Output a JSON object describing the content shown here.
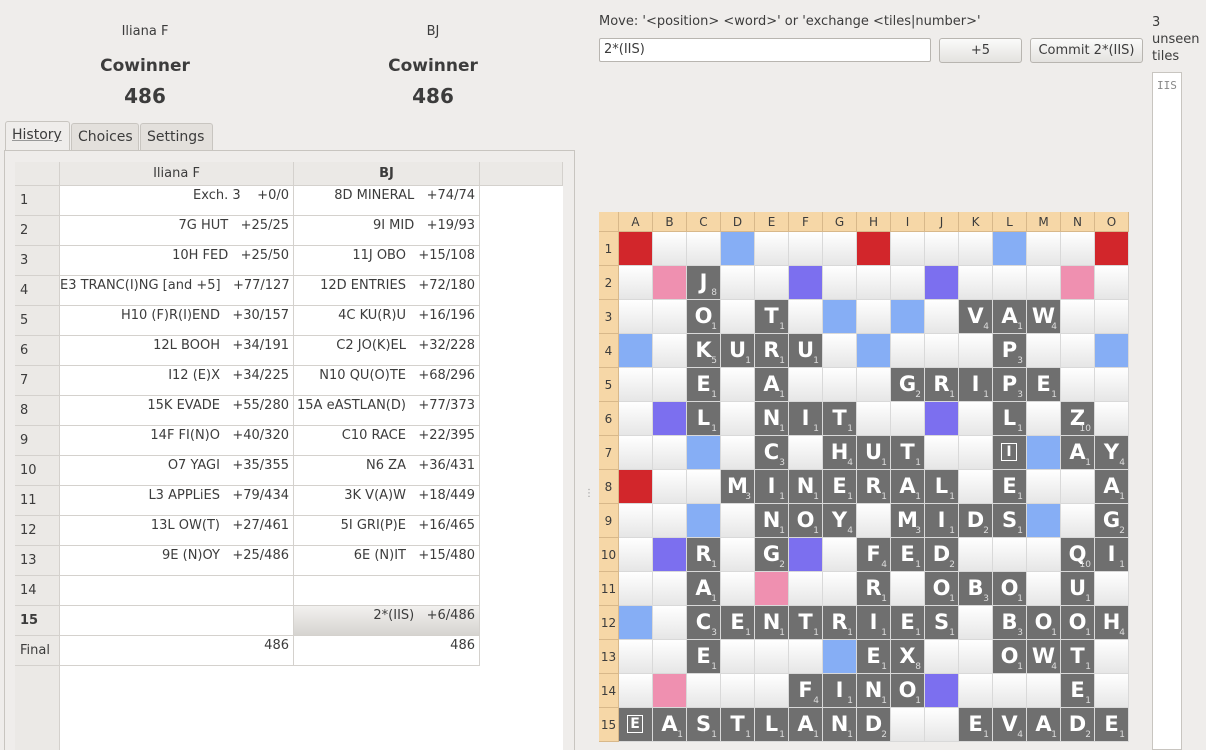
{
  "players": [
    {
      "name": "Iliana F",
      "status": "Cowinner",
      "score": "486"
    },
    {
      "name": "BJ",
      "status": "Cowinner",
      "score": "486"
    }
  ],
  "tabs": [
    "History",
    "Choices",
    "Settings"
  ],
  "history": {
    "columns": [
      "Iliana F",
      "BJ"
    ],
    "rows": [
      {
        "n": "1",
        "a": "Exch. 3    +0/0",
        "b": "8D MINERAL   +74/74"
      },
      {
        "n": "2",
        "a": "7G HUT   +25/25",
        "b": "9I MID   +19/93"
      },
      {
        "n": "3",
        "a": "10H FED   +25/50",
        "b": "11J OBO   +15/108"
      },
      {
        "n": "4",
        "a": "E3 TRANC(I)NG [and +5]   +77/127",
        "b": "12D ENTRIES   +72/180"
      },
      {
        "n": "5",
        "a": "H10 (F)R(I)END   +30/157",
        "b": "4C KU(R)U   +16/196"
      },
      {
        "n": "6",
        "a": "12L BOOH   +34/191",
        "b": "C2 JO(K)EL   +32/228"
      },
      {
        "n": "7",
        "a": "I12 (E)X   +34/225",
        "b": "N10 QU(O)TE   +68/296"
      },
      {
        "n": "8",
        "a": "15K EVADE   +55/280",
        "b": "15A eASTLAN(D)   +77/373"
      },
      {
        "n": "9",
        "a": "14F FI(N)O   +40/320",
        "b": "C10 RACE   +22/395"
      },
      {
        "n": "10",
        "a": "O7 YAGI   +35/355",
        "b": "N6 ZA   +36/431"
      },
      {
        "n": "11",
        "a": "L3 APPLiES   +79/434",
        "b": "3K V(A)W   +18/449"
      },
      {
        "n": "12",
        "a": "13L OW(T)   +27/461",
        "b": "5I GRI(P)E   +16/465"
      },
      {
        "n": "13",
        "a": "9E (N)OY   +25/486",
        "b": "6E (N)IT   +15/480"
      },
      {
        "n": "14",
        "a": "",
        "b": ""
      },
      {
        "n": "15",
        "a": "",
        "b": "2*(IIS)   +6/486"
      }
    ],
    "final": {
      "label": "Final",
      "a": "486",
      "b": "486"
    }
  },
  "move": {
    "label": "Move: '<position> <word>' or 'exchange <tiles|number>'",
    "value": "2*(IIS)",
    "plus_button": "+5",
    "commit_button": "Commit 2*(IIS)"
  },
  "unseen": {
    "label": "3 unseen tiles",
    "tiles": "IIS"
  },
  "board": {
    "cols": [
      "A",
      "B",
      "C",
      "D",
      "E",
      "F",
      "G",
      "H",
      "I",
      "J",
      "K",
      "L",
      "M",
      "N",
      "O"
    ],
    "rows": [
      "1",
      "2",
      "3",
      "4",
      "5",
      "6",
      "7",
      "8",
      "9",
      "10",
      "11",
      "12",
      "13",
      "14",
      "15"
    ],
    "premium": {
      "tw": [
        "A1",
        "H1",
        "O1",
        "A8"
      ],
      "dw": [
        "B2",
        "N2",
        "E11",
        "B14"
      ],
      "tl": [
        "F2",
        "J2",
        "B6",
        "J6",
        "B10",
        "F10",
        "J14"
      ],
      "dl": [
        "D1",
        "L1",
        "G3",
        "I3",
        "A4",
        "H4",
        "O4",
        "C7",
        "M7",
        "C9",
        "M9",
        "A12",
        "G13"
      ]
    },
    "tiles": [
      {
        "cell": "C2",
        "letter": "J",
        "points": "8"
      },
      {
        "cell": "C3",
        "letter": "O",
        "points": "1"
      },
      {
        "cell": "E3",
        "letter": "T",
        "points": "1"
      },
      {
        "cell": "K3",
        "letter": "V",
        "points": "4"
      },
      {
        "cell": "L3",
        "letter": "A",
        "points": "1"
      },
      {
        "cell": "M3",
        "letter": "W",
        "points": "4"
      },
      {
        "cell": "C4",
        "letter": "K",
        "points": "5"
      },
      {
        "cell": "D4",
        "letter": "U",
        "points": "1"
      },
      {
        "cell": "E4",
        "letter": "R",
        "points": "1"
      },
      {
        "cell": "F4",
        "letter": "U",
        "points": "1"
      },
      {
        "cell": "L4",
        "letter": "P",
        "points": "3"
      },
      {
        "cell": "C5",
        "letter": "E",
        "points": "1"
      },
      {
        "cell": "E5",
        "letter": "A",
        "points": "1"
      },
      {
        "cell": "I5",
        "letter": "G",
        "points": "2"
      },
      {
        "cell": "J5",
        "letter": "R",
        "points": "1"
      },
      {
        "cell": "K5",
        "letter": "I",
        "points": "1"
      },
      {
        "cell": "L5",
        "letter": "P",
        "points": "3"
      },
      {
        "cell": "M5",
        "letter": "E",
        "points": "1"
      },
      {
        "cell": "C6",
        "letter": "L",
        "points": "1"
      },
      {
        "cell": "E6",
        "letter": "N",
        "points": "1"
      },
      {
        "cell": "F6",
        "letter": "I",
        "points": "1"
      },
      {
        "cell": "G6",
        "letter": "T",
        "points": "1"
      },
      {
        "cell": "L6",
        "letter": "L",
        "points": "1"
      },
      {
        "cell": "N6",
        "letter": "Z",
        "points": "10"
      },
      {
        "cell": "E7",
        "letter": "C",
        "points": "3"
      },
      {
        "cell": "G7",
        "letter": "H",
        "points": "4"
      },
      {
        "cell": "H7",
        "letter": "U",
        "points": "1"
      },
      {
        "cell": "I7",
        "letter": "T",
        "points": "1"
      },
      {
        "cell": "L7",
        "letter": "I",
        "points": "",
        "blank": true
      },
      {
        "cell": "N7",
        "letter": "A",
        "points": "1"
      },
      {
        "cell": "O7",
        "letter": "Y",
        "points": "4"
      },
      {
        "cell": "D8",
        "letter": "M",
        "points": "3"
      },
      {
        "cell": "E8",
        "letter": "I",
        "points": "1"
      },
      {
        "cell": "F8",
        "letter": "N",
        "points": "1"
      },
      {
        "cell": "G8",
        "letter": "E",
        "points": "1"
      },
      {
        "cell": "H8",
        "letter": "R",
        "points": "1"
      },
      {
        "cell": "I8",
        "letter": "A",
        "points": "1"
      },
      {
        "cell": "J8",
        "letter": "L",
        "points": "1"
      },
      {
        "cell": "L8",
        "letter": "E",
        "points": "1"
      },
      {
        "cell": "O8",
        "letter": "A",
        "points": "1"
      },
      {
        "cell": "E9",
        "letter": "N",
        "points": "1"
      },
      {
        "cell": "F9",
        "letter": "O",
        "points": "1"
      },
      {
        "cell": "G9",
        "letter": "Y",
        "points": "4"
      },
      {
        "cell": "I9",
        "letter": "M",
        "points": "3"
      },
      {
        "cell": "J9",
        "letter": "I",
        "points": "1"
      },
      {
        "cell": "K9",
        "letter": "D",
        "points": "2"
      },
      {
        "cell": "L9",
        "letter": "S",
        "points": "1"
      },
      {
        "cell": "O9",
        "letter": "G",
        "points": "2"
      },
      {
        "cell": "C10",
        "letter": "R",
        "points": "1"
      },
      {
        "cell": "E10",
        "letter": "G",
        "points": "2"
      },
      {
        "cell": "H10",
        "letter": "F",
        "points": "4"
      },
      {
        "cell": "I10",
        "letter": "E",
        "points": "1"
      },
      {
        "cell": "J10",
        "letter": "D",
        "points": "2"
      },
      {
        "cell": "N10",
        "letter": "Q",
        "points": "10"
      },
      {
        "cell": "O10",
        "letter": "I",
        "points": "1"
      },
      {
        "cell": "C11",
        "letter": "A",
        "points": "1"
      },
      {
        "cell": "H11",
        "letter": "R",
        "points": "1"
      },
      {
        "cell": "J11",
        "letter": "O",
        "points": "1"
      },
      {
        "cell": "K11",
        "letter": "B",
        "points": "3"
      },
      {
        "cell": "L11",
        "letter": "O",
        "points": "1"
      },
      {
        "cell": "N11",
        "letter": "U",
        "points": "1"
      },
      {
        "cell": "C12",
        "letter": "C",
        "points": "3"
      },
      {
        "cell": "D12",
        "letter": "E",
        "points": "1"
      },
      {
        "cell": "E12",
        "letter": "N",
        "points": "1"
      },
      {
        "cell": "F12",
        "letter": "T",
        "points": "1"
      },
      {
        "cell": "G12",
        "letter": "R",
        "points": "1"
      },
      {
        "cell": "H12",
        "letter": "I",
        "points": "1"
      },
      {
        "cell": "I12",
        "letter": "E",
        "points": "1"
      },
      {
        "cell": "J12",
        "letter": "S",
        "points": "1"
      },
      {
        "cell": "L12",
        "letter": "B",
        "points": "3"
      },
      {
        "cell": "M12",
        "letter": "O",
        "points": "1"
      },
      {
        "cell": "N12",
        "letter": "O",
        "points": "1"
      },
      {
        "cell": "O12",
        "letter": "H",
        "points": "4"
      },
      {
        "cell": "C13",
        "letter": "E",
        "points": "1"
      },
      {
        "cell": "H13",
        "letter": "E",
        "points": "1"
      },
      {
        "cell": "I13",
        "letter": "X",
        "points": "8"
      },
      {
        "cell": "L13",
        "letter": "O",
        "points": "1"
      },
      {
        "cell": "M13",
        "letter": "W",
        "points": "4"
      },
      {
        "cell": "N13",
        "letter": "T",
        "points": "1"
      },
      {
        "cell": "F14",
        "letter": "F",
        "points": "4"
      },
      {
        "cell": "G14",
        "letter": "I",
        "points": "1"
      },
      {
        "cell": "H14",
        "letter": "N",
        "points": "1"
      },
      {
        "cell": "I14",
        "letter": "O",
        "points": "1"
      },
      {
        "cell": "N14",
        "letter": "E",
        "points": "1"
      },
      {
        "cell": "A15",
        "letter": "E",
        "points": "",
        "blank": true
      },
      {
        "cell": "B15",
        "letter": "A",
        "points": "1"
      },
      {
        "cell": "C15",
        "letter": "S",
        "points": "1"
      },
      {
        "cell": "D15",
        "letter": "T",
        "points": "1"
      },
      {
        "cell": "E15",
        "letter": "L",
        "points": "1"
      },
      {
        "cell": "F15",
        "letter": "A",
        "points": "1"
      },
      {
        "cell": "G15",
        "letter": "N",
        "points": "1"
      },
      {
        "cell": "H15",
        "letter": "D",
        "points": "2"
      },
      {
        "cell": "K15",
        "letter": "E",
        "points": "1"
      },
      {
        "cell": "L15",
        "letter": "V",
        "points": "4"
      },
      {
        "cell": "M15",
        "letter": "A",
        "points": "1"
      },
      {
        "cell": "N15",
        "letter": "D",
        "points": "2"
      },
      {
        "cell": "O15",
        "letter": "E",
        "points": "1"
      }
    ]
  }
}
